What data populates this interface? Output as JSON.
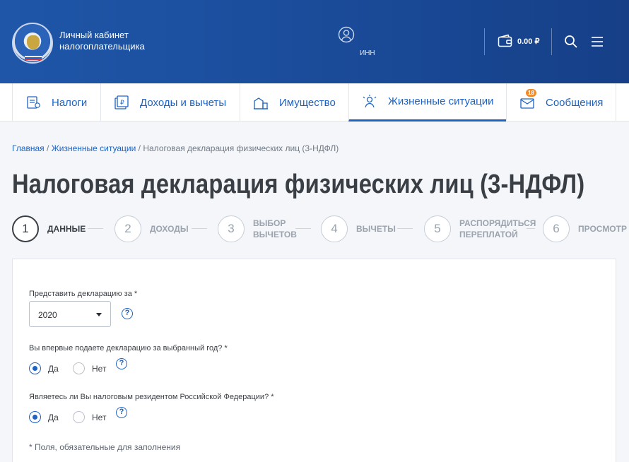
{
  "header": {
    "brand_line1": "Личный кабинет",
    "brand_line2": "налогоплательщика",
    "inn_label": "ИНН",
    "balance": "0.00 ₽",
    "icons": [
      "logo-emblem",
      "user-icon",
      "wallet-icon",
      "search-icon",
      "menu-icon"
    ]
  },
  "nav": {
    "items": [
      {
        "label": "Налоги",
        "icon": "taxes-icon"
      },
      {
        "label": "Доходы и вычеты",
        "icon": "income-icon"
      },
      {
        "label": "Имущество",
        "icon": "property-icon"
      },
      {
        "label": "Жизненные ситуации",
        "icon": "life-situations-icon",
        "active": true
      },
      {
        "label": "Сообщения",
        "icon": "messages-icon",
        "badge": "18"
      }
    ]
  },
  "breadcrumb": {
    "home": "Главная",
    "sep1": " / ",
    "section": "Жизненные ситуации",
    "sep2": " / ",
    "current": "Налоговая декларация физических лиц (3-НДФЛ)"
  },
  "page_title": "Налоговая декларация физических лиц (3-НДФЛ)",
  "steps": [
    {
      "num": "1",
      "label_line1": "Данные",
      "label_line2": "",
      "active": true
    },
    {
      "num": "2",
      "label_line1": "Доходы",
      "label_line2": ""
    },
    {
      "num": "3",
      "label_line1": "Выбор",
      "label_line2": "вычетов"
    },
    {
      "num": "4",
      "label_line1": "Вычеты",
      "label_line2": ""
    },
    {
      "num": "5",
      "label_line1": "Распорядиться",
      "label_line2": "переплатой"
    },
    {
      "num": "6",
      "label_line1": "Просмотр",
      "label_line2": ""
    }
  ],
  "form": {
    "year_question": "Представить декларацию за *",
    "year_value": "2020",
    "first_time_question": "Вы впервые подаете декларацию за выбранный год? *",
    "resident_question": "Являетесь ли Вы налоговым резидентом Российской Федерации? *",
    "yes": "Да",
    "no": "Нет",
    "first_time_selected": "Да",
    "resident_selected": "Да",
    "help_symbol": "?",
    "required_note": "* Поля, обязательные для заполнения"
  },
  "colors": {
    "header": "#1b4d9c",
    "accent": "#1d63c4",
    "badge": "#f08b2b"
  }
}
